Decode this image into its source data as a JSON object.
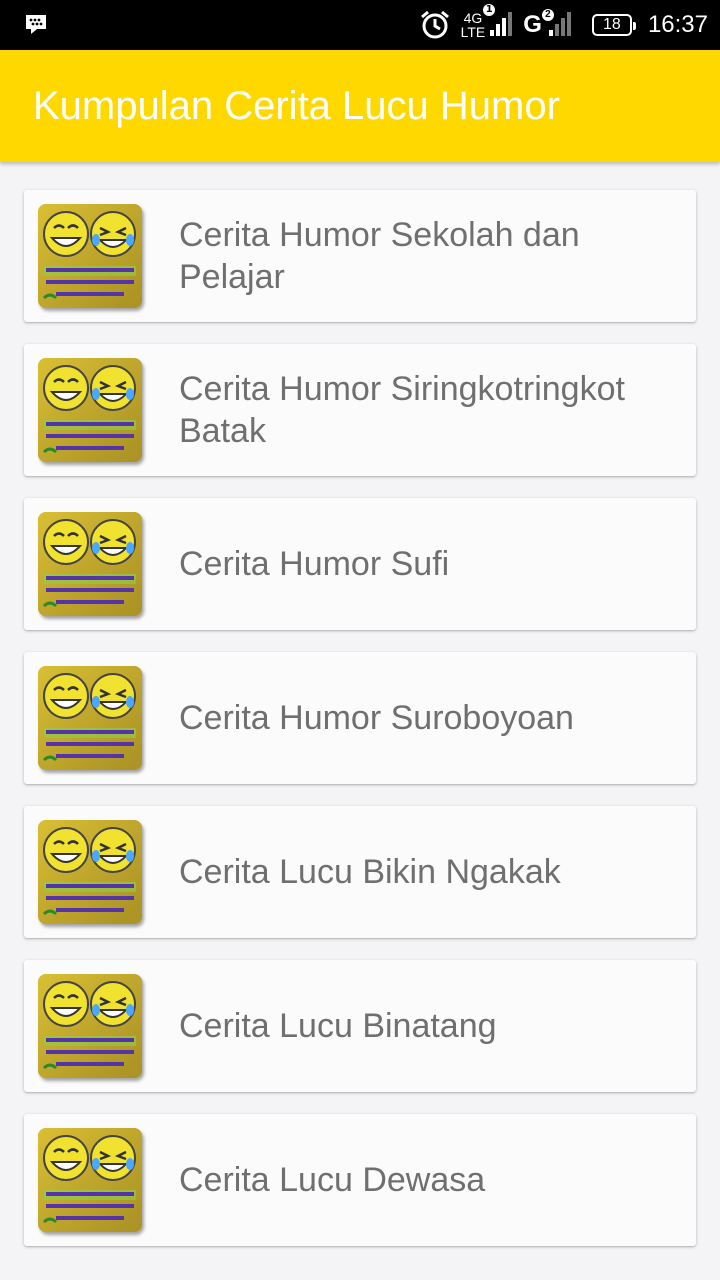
{
  "status_bar": {
    "network_top": "4G",
    "network_bottom": "LTE",
    "sim1_badge": "1",
    "network2": "G",
    "sim2_badge": "2",
    "battery_level": "18",
    "time": "16:37",
    "icons": [
      "bbm-icon",
      "alarm-icon",
      "signal-icon",
      "signal-icon",
      "battery-icon"
    ]
  },
  "app_bar": {
    "title": "Kumpulan Cerita Lucu Humor",
    "color": "#ffd800"
  },
  "list": {
    "items": [
      {
        "label": "Cerita Humor Sekolah dan Pelajar"
      },
      {
        "label": "Cerita Humor Siringkotringkot Batak"
      },
      {
        "label": "Cerita Humor Sufi"
      },
      {
        "label": "Cerita Humor Suroboyoan"
      },
      {
        "label": "Cerita Lucu Bikin Ngakak"
      },
      {
        "label": "Cerita Lucu Binatang"
      },
      {
        "label": "Cerita Lucu Dewasa"
      }
    ]
  }
}
